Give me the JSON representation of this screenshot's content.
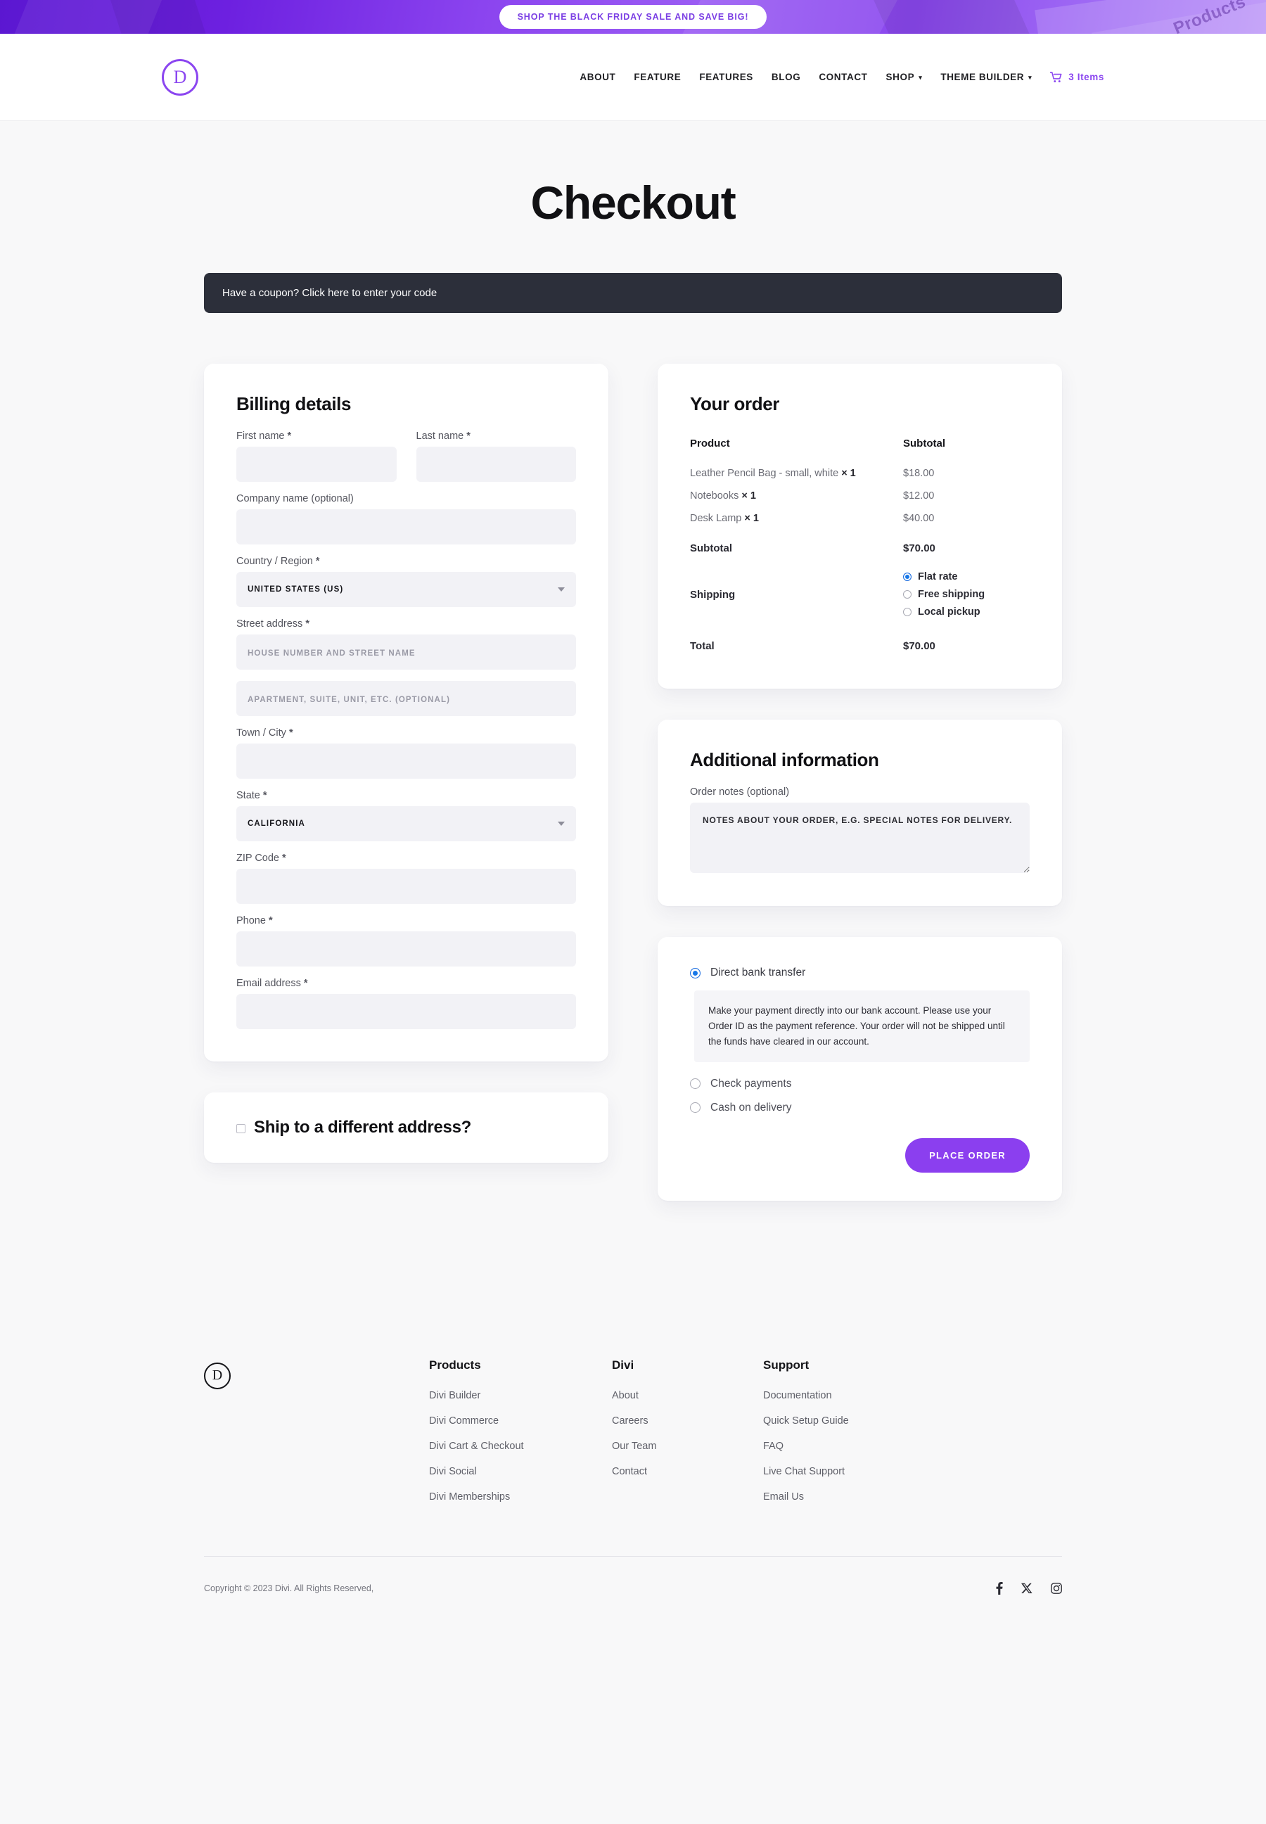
{
  "promo": {
    "banner_text": "Shop the Black Friday Sale and Save Big!",
    "ghost_text": "Products"
  },
  "header": {
    "logo_letter": "D",
    "nav_items": [
      {
        "label": "About",
        "has_caret": false
      },
      {
        "label": "Feature",
        "has_caret": false
      },
      {
        "label": "Features",
        "has_caret": false
      },
      {
        "label": "Blog",
        "has_caret": false
      },
      {
        "label": "Contact",
        "has_caret": false
      },
      {
        "label": "Shop",
        "has_caret": true
      },
      {
        "label": "Theme Builder",
        "has_caret": true
      }
    ],
    "cart_label": "3 Items",
    "cart_icon": "shopping-cart-icon"
  },
  "page": {
    "title": "Checkout",
    "coupon_text": "Have a coupon? Click here to enter your code"
  },
  "billing": {
    "title": "Billing details",
    "first_name_label": "First name",
    "last_name_label": "Last name",
    "company_label": "Company name (optional)",
    "country_label": "Country / Region",
    "country_value": "United States (US)",
    "street_label": "Street address",
    "street_placeholder": "House number and street name",
    "street2_placeholder": "Apartment, suite, unit, etc. (optional)",
    "city_label": "Town / City",
    "state_label": "State",
    "state_value": "California",
    "zip_label": "ZIP Code",
    "phone_label": "Phone",
    "email_label": "Email address",
    "required_mark": "*",
    "first_name_value": "",
    "last_name_value": "",
    "company_value": "",
    "city_value": "",
    "zip_value": "",
    "phone_value": "",
    "email_value": ""
  },
  "ship_different": {
    "label": "Ship to a different address?",
    "checked": false
  },
  "order": {
    "title": "Your order",
    "col_product": "Product",
    "col_subtotal": "Subtotal",
    "items": [
      {
        "name": "Leather Pencil Bag - small, white",
        "qty": "× 1",
        "price": "$18.00"
      },
      {
        "name": "Notebooks",
        "qty": "× 1",
        "price": "$12.00"
      },
      {
        "name": "Desk Lamp",
        "qty": "× 1",
        "price": "$40.00"
      }
    ],
    "subtotal_label": "Subtotal",
    "subtotal_value": "$70.00",
    "shipping_label": "Shipping",
    "shipping_options": [
      {
        "label": "Flat rate",
        "selected": true
      },
      {
        "label": "Free shipping",
        "selected": false
      },
      {
        "label": "Local pickup",
        "selected": false
      }
    ],
    "total_label": "Total",
    "total_value": "$70.00"
  },
  "additional": {
    "title": "Additional information",
    "notes_label": "Order notes (optional)",
    "notes_placeholder": "Notes about your order, e.g. special notes for delivery.",
    "notes_value": ""
  },
  "payment": {
    "options": [
      {
        "label": "Direct bank transfer",
        "selected": true
      },
      {
        "label": "Check payments",
        "selected": false
      },
      {
        "label": "Cash on delivery",
        "selected": false
      }
    ],
    "bank_description": "Make your payment directly into our bank account. Please use your Order ID as the payment reference. Your order will not be shipped until the funds have cleared in our account.",
    "place_order_label": "Place order"
  },
  "footer": {
    "logo_letter": "D",
    "columns": [
      {
        "heading": "Products",
        "links": [
          "Divi Builder",
          "Divi Commerce",
          "Divi Cart & Checkout",
          "Divi Social",
          "Divi Memberships"
        ]
      },
      {
        "heading": "Divi",
        "links": [
          "About",
          "Careers",
          "Our Team",
          "Contact"
        ]
      },
      {
        "heading": "Support",
        "links": [
          "Documentation",
          "Quick Setup Guide",
          "FAQ",
          "Live Chat Support",
          "Email Us"
        ]
      }
    ],
    "copyright": "Copyright © 2023 Divi. All Rights Reserved,",
    "social": [
      {
        "name": "facebook-icon"
      },
      {
        "name": "x-twitter-icon"
      },
      {
        "name": "instagram-icon"
      }
    ]
  },
  "colors": {
    "accent_purple": "#8b46f0",
    "button_purple": "#8b3fef",
    "coupon_dark": "#2c2f3a",
    "radio_blue": "#1677e8",
    "page_bg": "#f8f8f9",
    "field_bg": "#f2f2f6"
  }
}
